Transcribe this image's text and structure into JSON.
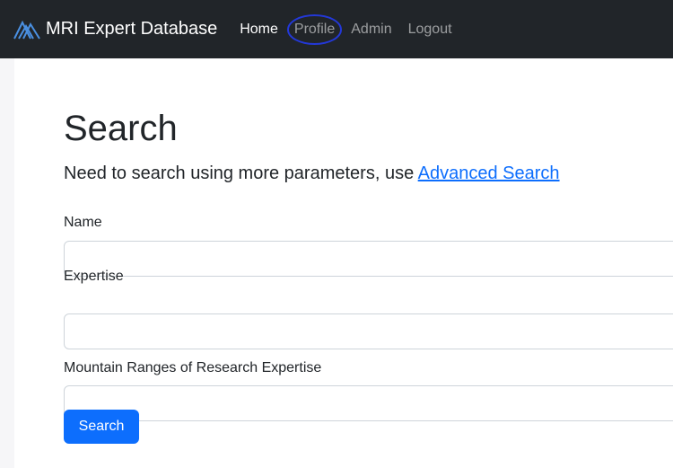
{
  "navbar": {
    "brand": "MRI Expert Database",
    "links": [
      "Home",
      "Profile",
      "Admin",
      "Logout"
    ]
  },
  "search": {
    "title": "Search",
    "lead_text": "Need to search using more parameters, use ",
    "advanced_link": "Advanced Search",
    "fields": [
      {
        "label": "Name",
        "value": "",
        "placeholder": ""
      },
      {
        "label": "Expertise",
        "value": "",
        "placeholder": ""
      },
      {
        "label": "Mountain Ranges of Research Expertise",
        "value": "",
        "placeholder": ""
      }
    ],
    "submit_label": "Search"
  },
  "colors": {
    "navbar_bg": "#212529",
    "primary": "#0d6efd",
    "annotation_circle": "#2338d8"
  }
}
